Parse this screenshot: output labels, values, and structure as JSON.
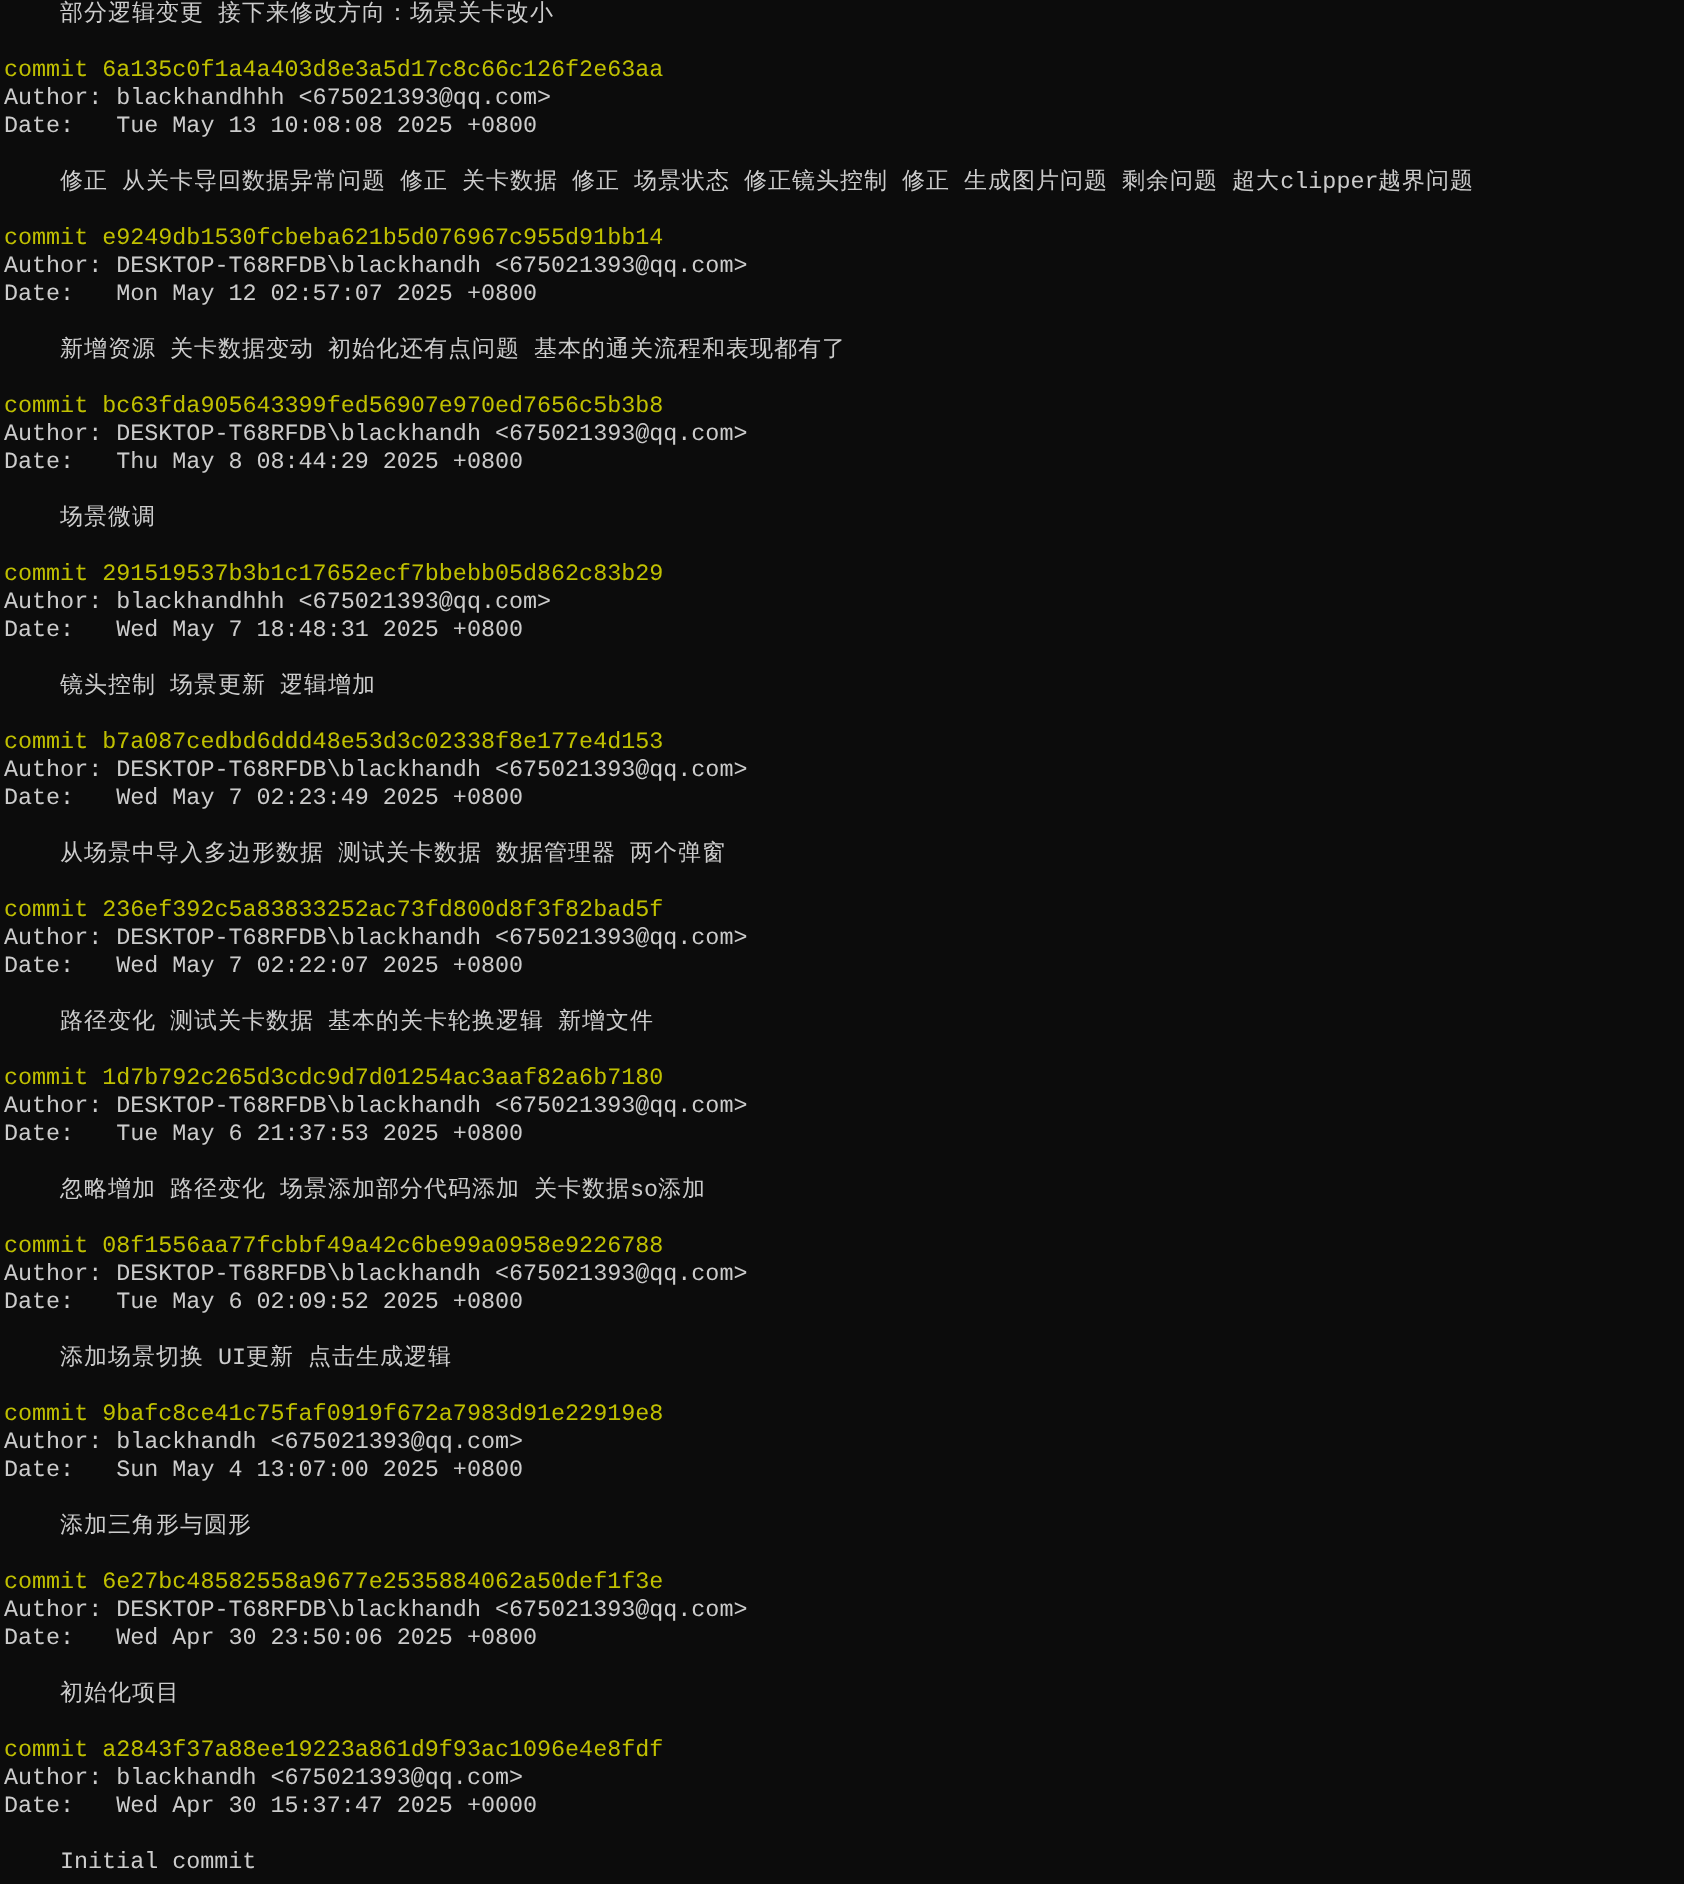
{
  "top_message": "部分逻辑变更 接下来修改方向：场景关卡改小",
  "commits": [
    {
      "commit": "commit 6a135c0f1a4a403d8e3a5d17c8c66c126f2e63aa",
      "author": "Author: blackhandhhh <675021393@qq.com>",
      "date": "Date:   Tue May 13 10:08:08 2025 +0800",
      "message": "修正 从关卡导回数据异常问题 修正 关卡数据 修正 场景状态 修正镜头控制 修正 生成图片问题 剩余问题 超大clipper越界问题"
    },
    {
      "commit": "commit e9249db1530fcbeba621b5d076967c955d91bb14",
      "author": "Author: DESKTOP-T68RFDB\\blackhandh <675021393@qq.com>",
      "date": "Date:   Mon May 12 02:57:07 2025 +0800",
      "message": "新增资源 关卡数据变动 初始化还有点问题 基本的通关流程和表现都有了"
    },
    {
      "commit": "commit bc63fda905643399fed56907e970ed7656c5b3b8",
      "author": "Author: DESKTOP-T68RFDB\\blackhandh <675021393@qq.com>",
      "date": "Date:   Thu May 8 08:44:29 2025 +0800",
      "message": "场景微调"
    },
    {
      "commit": "commit 291519537b3b1c17652ecf7bbebb05d862c83b29",
      "author": "Author: blackhandhhh <675021393@qq.com>",
      "date": "Date:   Wed May 7 18:48:31 2025 +0800",
      "message": "镜头控制 场景更新 逻辑增加"
    },
    {
      "commit": "commit b7a087cedbd6ddd48e53d3c02338f8e177e4d153",
      "author": "Author: DESKTOP-T68RFDB\\blackhandh <675021393@qq.com>",
      "date": "Date:   Wed May 7 02:23:49 2025 +0800",
      "message": "从场景中导入多边形数据 测试关卡数据 数据管理器 两个弹窗"
    },
    {
      "commit": "commit 236ef392c5a83833252ac73fd800d8f3f82bad5f",
      "author": "Author: DESKTOP-T68RFDB\\blackhandh <675021393@qq.com>",
      "date": "Date:   Wed May 7 02:22:07 2025 +0800",
      "message": "路径变化 测试关卡数据 基本的关卡轮换逻辑 新增文件"
    },
    {
      "commit": "commit 1d7b792c265d3cdc9d7d01254ac3aaf82a6b7180",
      "author": "Author: DESKTOP-T68RFDB\\blackhandh <675021393@qq.com>",
      "date": "Date:   Tue May 6 21:37:53 2025 +0800",
      "message": "忽略增加 路径变化 场景添加部分代码添加 关卡数据so添加"
    },
    {
      "commit": "commit 08f1556aa77fcbbf49a42c6be99a0958e9226788",
      "author": "Author: DESKTOP-T68RFDB\\blackhandh <675021393@qq.com>",
      "date": "Date:   Tue May 6 02:09:52 2025 +0800",
      "message": "添加场景切换 UI更新 点击生成逻辑"
    },
    {
      "commit": "commit 9bafc8ce41c75faf0919f672a7983d91e22919e8",
      "author": "Author: blackhandh <675021393@qq.com>",
      "date": "Date:   Sun May 4 13:07:00 2025 +0800",
      "message": "添加三角形与圆形"
    },
    {
      "commit": "commit 6e27bc48582558a9677e2535884062a50def1f3e",
      "author": "Author: DESKTOP-T68RFDB\\blackhandh <675021393@qq.com>",
      "date": "Date:   Wed Apr 30 23:50:06 2025 +0800",
      "message": "初始化项目"
    },
    {
      "commit": "commit a2843f37a88ee19223a861d9f93ac1096e4e8fdf",
      "author": "Author: blackhandh <675021393@qq.com>",
      "date": "Date:   Wed Apr 30 15:37:47 2025 +0000",
      "message": "Initial commit"
    }
  ]
}
